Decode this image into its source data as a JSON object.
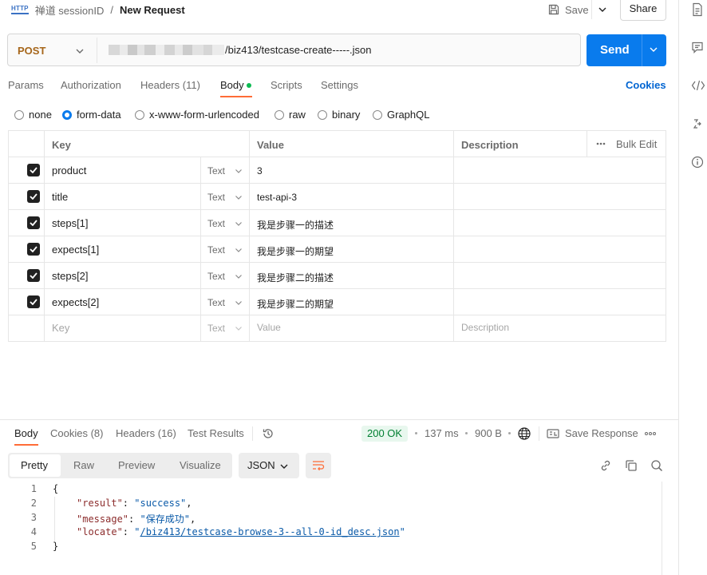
{
  "header": {
    "badge": "HTTP",
    "parent": "禅道 sessionID",
    "separator": "/",
    "title": "New Request",
    "save_label": "Save",
    "share_label": "Share"
  },
  "request": {
    "method": "POST",
    "url_visible": "/biz413/testcase-create-----.json",
    "send_label": "Send"
  },
  "tabs": {
    "items": [
      "Params",
      "Authorization",
      "Headers (11)",
      "Body",
      "Scripts",
      "Settings"
    ],
    "active": "Body",
    "cookies_label": "Cookies"
  },
  "body_types": {
    "options": [
      "none",
      "form-data",
      "x-www-form-urlencoded",
      "raw",
      "binary",
      "GraphQL"
    ],
    "selected": "form-data"
  },
  "params_table": {
    "headers": {
      "key": "Key",
      "value": "Value",
      "description": "Description",
      "bulk_edit": "Bulk Edit"
    },
    "rows": [
      {
        "checked": true,
        "key": "product",
        "type": "Text",
        "value": "3"
      },
      {
        "checked": true,
        "key": "title",
        "type": "Text",
        "value": "test-api-3"
      },
      {
        "checked": true,
        "key": "steps[1]",
        "type": "Text",
        "value": "我是步骤一的描述"
      },
      {
        "checked": true,
        "key": "expects[1]",
        "type": "Text",
        "value": "我是步骤一的期望"
      },
      {
        "checked": true,
        "key": "steps[2]",
        "type": "Text",
        "value": "我是步骤二的描述"
      },
      {
        "checked": true,
        "key": "expects[2]",
        "type": "Text",
        "value": "我是步骤二的期望"
      }
    ],
    "placeholder": {
      "key": "Key",
      "type": "Text",
      "value": "Value",
      "description": "Description"
    }
  },
  "response": {
    "tabs": [
      "Body",
      "Cookies (8)",
      "Headers (16)",
      "Test Results"
    ],
    "active_tab": "Body",
    "status": "200 OK",
    "time": "137 ms",
    "size": "900 B",
    "save_response": "Save Response",
    "more": "ooo",
    "view_modes": [
      "Pretty",
      "Raw",
      "Preview",
      "Visualize"
    ],
    "active_view": "Pretty",
    "format": "JSON",
    "line_numbers": [
      "1",
      "2",
      "3",
      "4",
      "5"
    ],
    "json": {
      "open": "{",
      "close": "}",
      "result_key": "\"result\"",
      "result_val": "\"success\"",
      "message_key": "\"message\"",
      "message_val": "\"保存成功\"",
      "locate_key": "\"locate\"",
      "locate_val": "/biz413/testcase-browse-3--all-0-id_desc.json"
    }
  },
  "colors": {
    "accent": "#ff6c37",
    "send": "#097bed",
    "method": "#a6661a",
    "success": "#007f31"
  }
}
